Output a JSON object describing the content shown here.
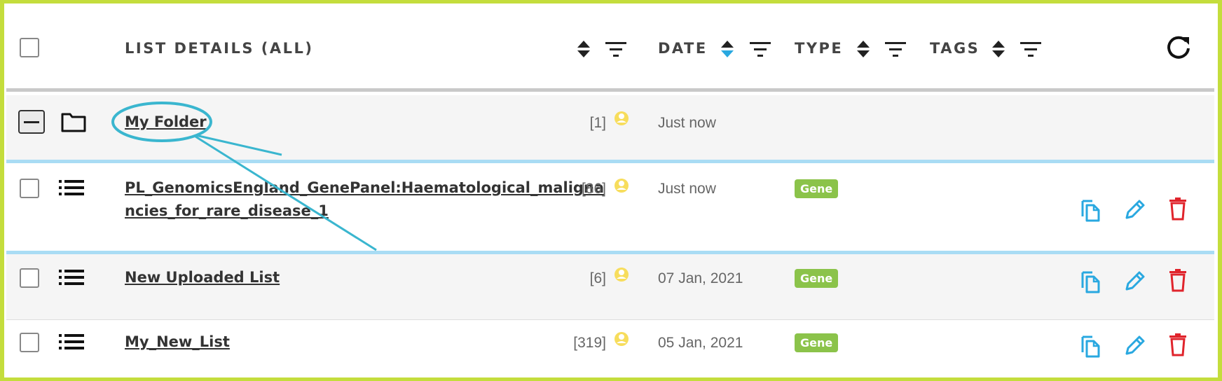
{
  "header": {
    "list_details_label": "LIST DETAILS (ALL)",
    "date_label": "DATE",
    "type_label": "TYPE",
    "tags_label": "TAGS"
  },
  "icons": {
    "header": [
      "select-all-checkbox",
      "sort-icon",
      "filter-icon",
      "refresh-icon"
    ],
    "rows": [
      "checkbox",
      "folder-icon",
      "list-icon",
      "owner-icon",
      "copy-icon",
      "edit-icon",
      "delete-icon"
    ]
  },
  "rows": [
    {
      "kind": "folder",
      "name": "My Folder",
      "count": "[1]",
      "date": "Just now",
      "type": ""
    },
    {
      "kind": "list",
      "name_line1": "PL_GenomicsEngland_GenePanel:Haematological_maligna",
      "name_line2": "ncies_for_rare_disease_1",
      "count": "[86]",
      "date": "Just now",
      "type": "Gene"
    },
    {
      "kind": "list",
      "name": "New Uploaded List",
      "count": "[6]",
      "date": "07 Jan, 2021",
      "type": "Gene"
    },
    {
      "kind": "list",
      "name": "My_New_List",
      "count": "[319]",
      "date": "05 Jan, 2021",
      "type": "Gene"
    }
  ],
  "colors": {
    "frame": "#c4dd3c",
    "annotation": "#3ab6cf",
    "row_separator": "#a9dcf4",
    "badge": "#8bc34a",
    "action_blue": "#29a8e0",
    "delete_red": "#e0242c",
    "owner_yellow": "#f7dd5c",
    "sort_active": "#29a8e0"
  }
}
